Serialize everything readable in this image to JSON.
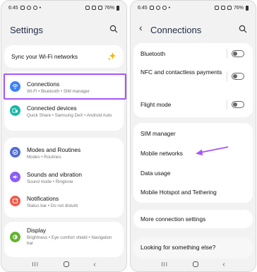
{
  "left": {
    "status_time": "6:45",
    "status_battery": "76%",
    "title": "Settings",
    "sync": {
      "label": "Sync your Wi-Fi networks"
    },
    "items": [
      {
        "title": "Connections",
        "sub": "Wi-Fi  •  Bluetooth  •  SIM manager",
        "color": "#3b82f6"
      },
      {
        "title": "Connected devices",
        "sub": "Quick Share  •  Samsung DeX  •  Android Auto",
        "color": "#14b8a6"
      },
      {
        "title": "Modes and Routines",
        "sub": "Modes  •  Routines",
        "color": "#4f6bd8"
      },
      {
        "title": "Sounds and vibration",
        "sub": "Sound mode  •  Ringtone",
        "color": "#8b5cf6"
      },
      {
        "title": "Notifications",
        "sub": "Status bar  •  Do not disturb",
        "color": "#f05a4a"
      },
      {
        "title": "Display",
        "sub": "Brightness  •  Eye comfort shield  •  Navigation bar",
        "color": "#65b32e"
      }
    ]
  },
  "right": {
    "status_time": "6:45",
    "status_battery": "76%",
    "title": "Connections",
    "toggles": [
      {
        "title": "Bluetooth"
      },
      {
        "title": "NFC and contactless payments"
      },
      {
        "title": "Flight mode"
      }
    ],
    "menu": [
      {
        "title": "SIM manager"
      },
      {
        "title": "Mobile networks"
      },
      {
        "title": "Data usage"
      },
      {
        "title": "Mobile Hotspot and Tethering"
      }
    ],
    "more": {
      "title": "More connection settings"
    },
    "looking": {
      "title": "Looking for something else?"
    }
  },
  "colors": {
    "highlight": "#a855f7",
    "accent": "#f5b400"
  }
}
